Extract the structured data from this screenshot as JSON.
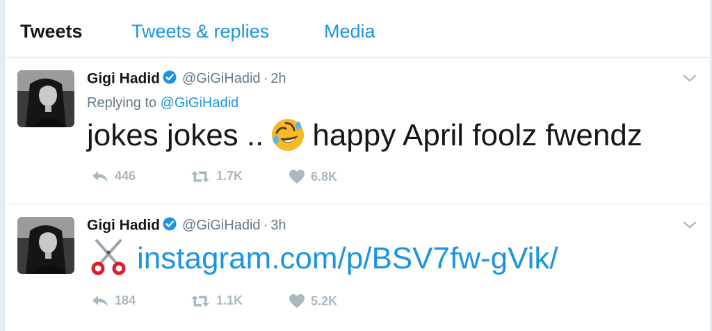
{
  "tabs": [
    {
      "label": "Tweets",
      "active": true
    },
    {
      "label": "Tweets & replies",
      "active": false
    },
    {
      "label": "Media",
      "active": false
    }
  ],
  "colors": {
    "accent": "#1b95e0",
    "text": "#14171a",
    "muted": "#657786",
    "action": "#aab8c2"
  },
  "tweets": [
    {
      "name": "Gigi Hadid",
      "handle": "@GiGiHadid",
      "separator": "·",
      "time": "2h",
      "replying_prefix": "Replying to",
      "replying_to": "@GiGiHadid",
      "text_before": "jokes jokes ..",
      "emoji": "rolling-on-floor-laughing-emoji",
      "text_after": "happy April foolz fwendz",
      "replies": "446",
      "retweets": "1.7K",
      "likes": "6.8K"
    },
    {
      "name": "Gigi Hadid",
      "handle": "@GiGiHadid",
      "separator": "·",
      "time": "3h",
      "emoji": "scissors-emoji",
      "link": "instagram.com/p/BSV7fw-gVik/",
      "replies": "184",
      "retweets": "1.1K",
      "likes": "5.2K"
    }
  ]
}
